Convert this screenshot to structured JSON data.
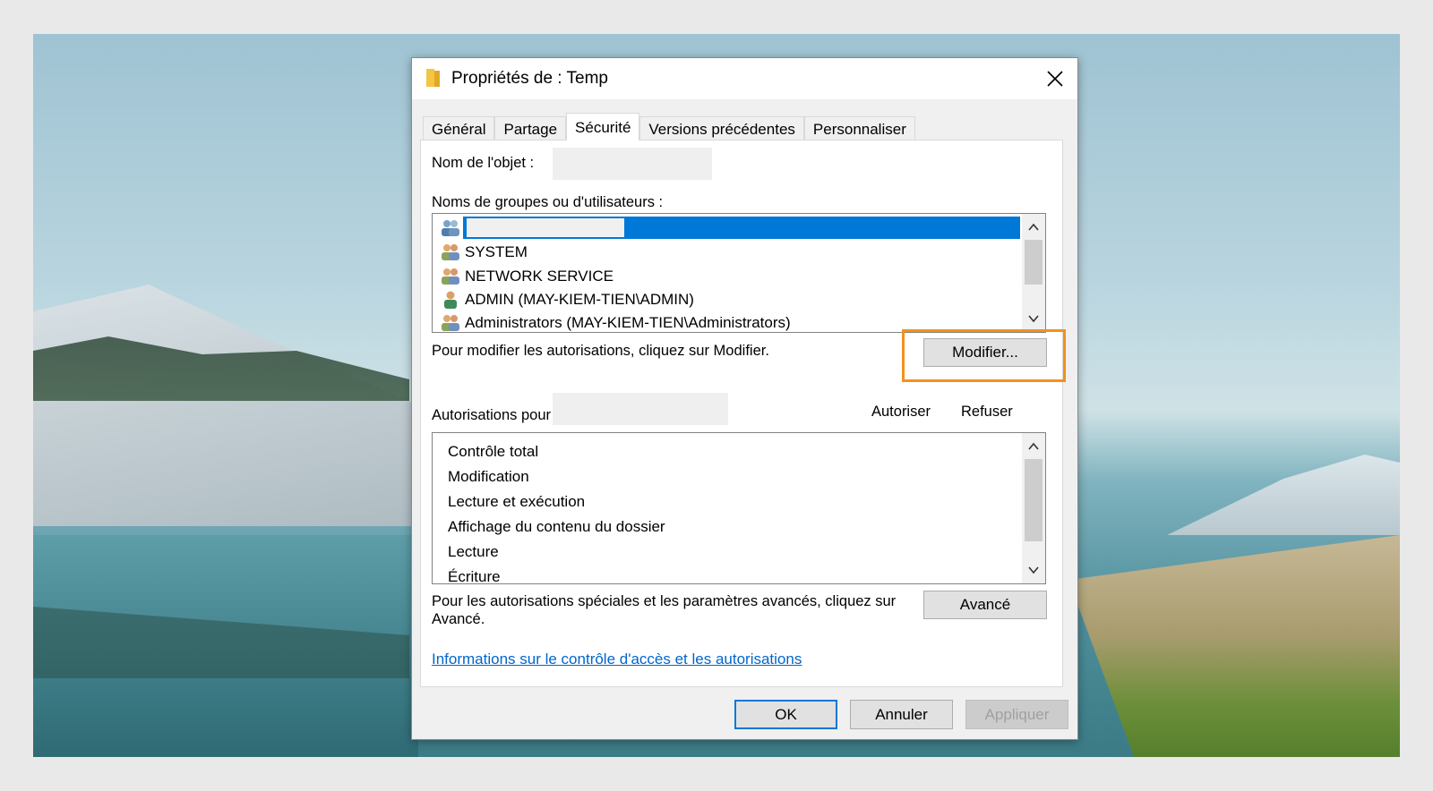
{
  "window": {
    "title": "Propriétés de : Temp",
    "close_icon": "close-icon",
    "folder_icon": "folder-icon"
  },
  "tabs": [
    {
      "label": "Général",
      "active": false
    },
    {
      "label": "Partage",
      "active": false
    },
    {
      "label": "Sécurité",
      "active": true
    },
    {
      "label": "Versions précédentes",
      "active": false
    },
    {
      "label": "Personnaliser",
      "active": false
    }
  ],
  "security": {
    "object_name_label": "Nom de l'objet :",
    "groups_label": "Noms de groupes ou d'utilisateurs :",
    "principals": [
      {
        "name": "",
        "icon": "group-users-icon",
        "selected": true
      },
      {
        "name": "SYSTEM",
        "icon": "group-users-icon",
        "selected": false
      },
      {
        "name": "NETWORK SERVICE",
        "icon": "group-users-icon",
        "selected": false
      },
      {
        "name": "ADMIN (MAY-KIEM-TIEN\\ADMIN)",
        "icon": "single-user-icon",
        "selected": false
      },
      {
        "name": "Administrators (MAY-KIEM-TIEN\\Administrators)",
        "icon": "group-users-icon",
        "selected": false
      }
    ],
    "modify_hint": "Pour modifier les autorisations, cliquez sur Modifier.",
    "modify_button": "Modifier...",
    "permissions_for_label": "Autorisations pour",
    "allow_header": "Autoriser",
    "deny_header": "Refuser",
    "permissions": [
      "Contrôle total",
      "Modification",
      "Lecture et exécution",
      "Affichage du contenu du dossier",
      "Lecture",
      "Écriture"
    ],
    "advanced_hint_line1": "Pour les autorisations spéciales et les paramètres avancés, cliquez sur",
    "advanced_hint_line2": "Avancé.",
    "advanced_button": "Avancé",
    "info_link": "Informations sur le contrôle d'accès et les autorisations"
  },
  "footer": {
    "ok": "OK",
    "cancel": "Annuler",
    "apply": "Appliquer"
  },
  "colors": {
    "selection": "#0078d7",
    "highlight_frame": "#f0921e",
    "link": "#0066cc"
  }
}
